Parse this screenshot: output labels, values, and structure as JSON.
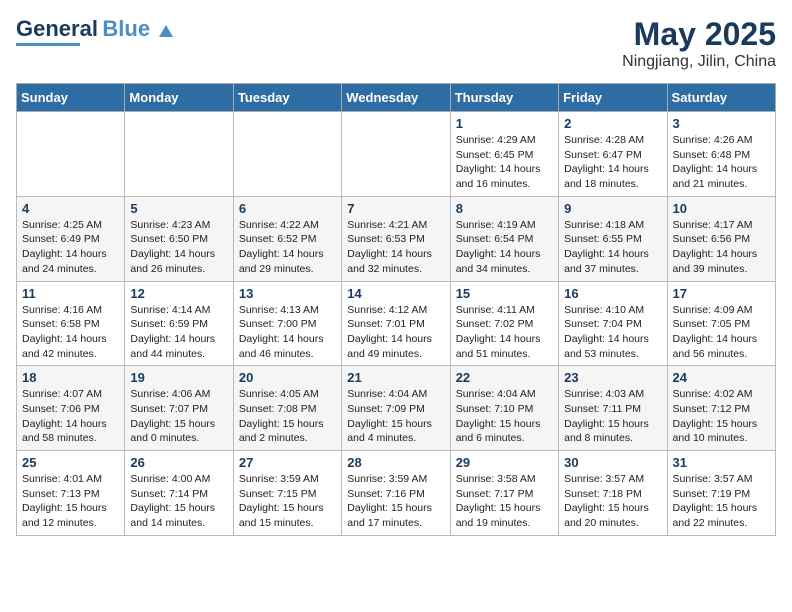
{
  "logo": {
    "line1": "General",
    "line2": "Blue"
  },
  "title": {
    "month_year": "May 2025",
    "location": "Ningjiang, Jilin, China"
  },
  "weekdays": [
    "Sunday",
    "Monday",
    "Tuesday",
    "Wednesday",
    "Thursday",
    "Friday",
    "Saturday"
  ],
  "weeks": [
    [
      {
        "day": "",
        "info": ""
      },
      {
        "day": "",
        "info": ""
      },
      {
        "day": "",
        "info": ""
      },
      {
        "day": "",
        "info": ""
      },
      {
        "day": "1",
        "info": "Sunrise: 4:29 AM\nSunset: 6:45 PM\nDaylight: 14 hours\nand 16 minutes."
      },
      {
        "day": "2",
        "info": "Sunrise: 4:28 AM\nSunset: 6:47 PM\nDaylight: 14 hours\nand 18 minutes."
      },
      {
        "day": "3",
        "info": "Sunrise: 4:26 AM\nSunset: 6:48 PM\nDaylight: 14 hours\nand 21 minutes."
      }
    ],
    [
      {
        "day": "4",
        "info": "Sunrise: 4:25 AM\nSunset: 6:49 PM\nDaylight: 14 hours\nand 24 minutes."
      },
      {
        "day": "5",
        "info": "Sunrise: 4:23 AM\nSunset: 6:50 PM\nDaylight: 14 hours\nand 26 minutes."
      },
      {
        "day": "6",
        "info": "Sunrise: 4:22 AM\nSunset: 6:52 PM\nDaylight: 14 hours\nand 29 minutes."
      },
      {
        "day": "7",
        "info": "Sunrise: 4:21 AM\nSunset: 6:53 PM\nDaylight: 14 hours\nand 32 minutes."
      },
      {
        "day": "8",
        "info": "Sunrise: 4:19 AM\nSunset: 6:54 PM\nDaylight: 14 hours\nand 34 minutes."
      },
      {
        "day": "9",
        "info": "Sunrise: 4:18 AM\nSunset: 6:55 PM\nDaylight: 14 hours\nand 37 minutes."
      },
      {
        "day": "10",
        "info": "Sunrise: 4:17 AM\nSunset: 6:56 PM\nDaylight: 14 hours\nand 39 minutes."
      }
    ],
    [
      {
        "day": "11",
        "info": "Sunrise: 4:16 AM\nSunset: 6:58 PM\nDaylight: 14 hours\nand 42 minutes."
      },
      {
        "day": "12",
        "info": "Sunrise: 4:14 AM\nSunset: 6:59 PM\nDaylight: 14 hours\nand 44 minutes."
      },
      {
        "day": "13",
        "info": "Sunrise: 4:13 AM\nSunset: 7:00 PM\nDaylight: 14 hours\nand 46 minutes."
      },
      {
        "day": "14",
        "info": "Sunrise: 4:12 AM\nSunset: 7:01 PM\nDaylight: 14 hours\nand 49 minutes."
      },
      {
        "day": "15",
        "info": "Sunrise: 4:11 AM\nSunset: 7:02 PM\nDaylight: 14 hours\nand 51 minutes."
      },
      {
        "day": "16",
        "info": "Sunrise: 4:10 AM\nSunset: 7:04 PM\nDaylight: 14 hours\nand 53 minutes."
      },
      {
        "day": "17",
        "info": "Sunrise: 4:09 AM\nSunset: 7:05 PM\nDaylight: 14 hours\nand 56 minutes."
      }
    ],
    [
      {
        "day": "18",
        "info": "Sunrise: 4:07 AM\nSunset: 7:06 PM\nDaylight: 14 hours\nand 58 minutes."
      },
      {
        "day": "19",
        "info": "Sunrise: 4:06 AM\nSunset: 7:07 PM\nDaylight: 15 hours\nand 0 minutes."
      },
      {
        "day": "20",
        "info": "Sunrise: 4:05 AM\nSunset: 7:08 PM\nDaylight: 15 hours\nand 2 minutes."
      },
      {
        "day": "21",
        "info": "Sunrise: 4:04 AM\nSunset: 7:09 PM\nDaylight: 15 hours\nand 4 minutes."
      },
      {
        "day": "22",
        "info": "Sunrise: 4:04 AM\nSunset: 7:10 PM\nDaylight: 15 hours\nand 6 minutes."
      },
      {
        "day": "23",
        "info": "Sunrise: 4:03 AM\nSunset: 7:11 PM\nDaylight: 15 hours\nand 8 minutes."
      },
      {
        "day": "24",
        "info": "Sunrise: 4:02 AM\nSunset: 7:12 PM\nDaylight: 15 hours\nand 10 minutes."
      }
    ],
    [
      {
        "day": "25",
        "info": "Sunrise: 4:01 AM\nSunset: 7:13 PM\nDaylight: 15 hours\nand 12 minutes."
      },
      {
        "day": "26",
        "info": "Sunrise: 4:00 AM\nSunset: 7:14 PM\nDaylight: 15 hours\nand 14 minutes."
      },
      {
        "day": "27",
        "info": "Sunrise: 3:59 AM\nSunset: 7:15 PM\nDaylight: 15 hours\nand 15 minutes."
      },
      {
        "day": "28",
        "info": "Sunrise: 3:59 AM\nSunset: 7:16 PM\nDaylight: 15 hours\nand 17 minutes."
      },
      {
        "day": "29",
        "info": "Sunrise: 3:58 AM\nSunset: 7:17 PM\nDaylight: 15 hours\nand 19 minutes."
      },
      {
        "day": "30",
        "info": "Sunrise: 3:57 AM\nSunset: 7:18 PM\nDaylight: 15 hours\nand 20 minutes."
      },
      {
        "day": "31",
        "info": "Sunrise: 3:57 AM\nSunset: 7:19 PM\nDaylight: 15 hours\nand 22 minutes."
      }
    ]
  ]
}
